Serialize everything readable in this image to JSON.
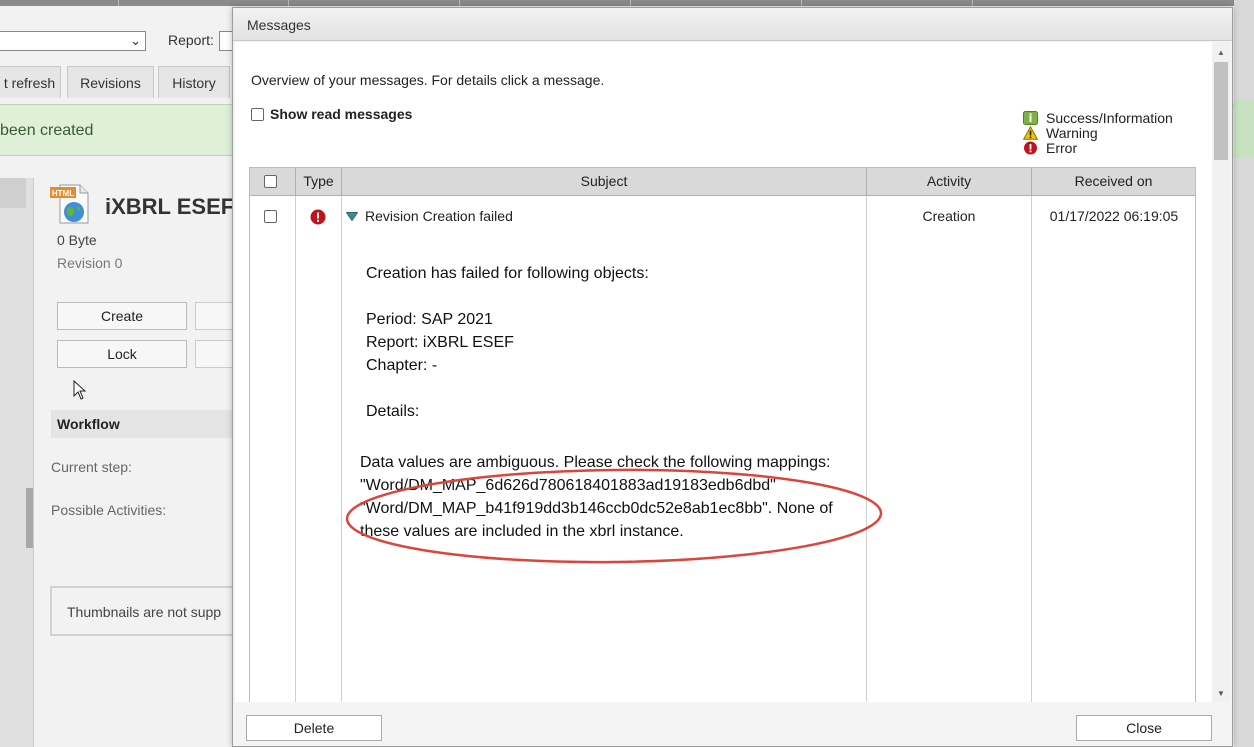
{
  "background": {
    "report_label": "Report:",
    "tabs": [
      "t refresh",
      "Revisions",
      "History"
    ],
    "banner_text": "been created",
    "file_icon_label": "HTML",
    "file_title": "iXBRL ESEF",
    "file_size": "0 Byte",
    "revision": "Revision 0",
    "buttons": {
      "create": "Create",
      "lock": "Lock"
    },
    "workflow_header": "Workflow",
    "current_step_label": "Current step:",
    "possible_activities_label": "Possible Activities:",
    "thumbnails_text": "Thumbnails are not supp"
  },
  "dialog": {
    "title": "Messages",
    "overview": "Overview of your messages. For details click a message.",
    "show_read_label": "Show read messages",
    "legend": {
      "success": "Success/Information",
      "warning": "Warning",
      "error": "Error"
    },
    "columns": {
      "type": "Type",
      "subject": "Subject",
      "activity": "Activity",
      "received": "Received on"
    },
    "message": {
      "subject": "Revision Creation failed",
      "activity": "Creation",
      "received": "01/17/2022 06:19:05",
      "line_failed": "Creation has failed for following objects:",
      "line_period": "Period: SAP 2021",
      "line_report": "Report: iXBRL ESEF",
      "line_chapter": "Chapter: -",
      "line_details": "Details:",
      "error_line1": "Data values are ambiguous. Please check the following mappings:",
      "error_line2": "\"Word/DM_MAP_6d626d780618401883ad19183edb6dbd\"",
      "error_line3": "\"Word/DM_MAP_b41f919dd3b146ccb0dc52e8ab1ec8bb\". None of",
      "error_line4": "these values are included in the xbrl instance."
    },
    "buttons": {
      "delete": "Delete",
      "close": "Close"
    }
  },
  "colors": {
    "error_red": "#c0141c",
    "success_green": "#7cb342",
    "warning_yellow": "#f2c200",
    "highlight_ellipse": "#d9463e",
    "banner_green": "#dff0d8"
  }
}
